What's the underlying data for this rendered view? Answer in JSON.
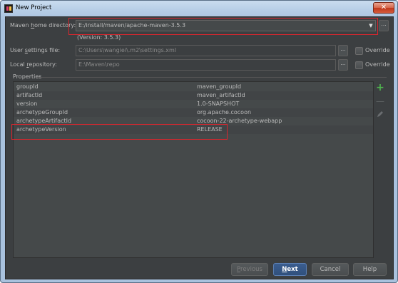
{
  "window": {
    "title": "New Project",
    "close_label": "✕"
  },
  "maven_home": {
    "label_pre": "Maven ",
    "label_u": "h",
    "label_post": "ome directory:",
    "value": "E:/install/maven/apache-maven-3.5.3",
    "version": "(Version: 3.5.3)"
  },
  "user_settings": {
    "label_pre": "User ",
    "label_u": "s",
    "label_post": "ettings file:",
    "value": "C:\\Users\\wangiei\\.m2\\settings.xml",
    "override_label": "Override",
    "override_checked": false
  },
  "local_repo": {
    "label_pre": "Local ",
    "label_u": "r",
    "label_post": "epository:",
    "value": "E:\\Maven\\repo",
    "override_label": "Override",
    "override_checked": false
  },
  "properties": {
    "title": "Properties",
    "rows": [
      {
        "key": "groupId",
        "value": "maven_groupId"
      },
      {
        "key": "artifactId",
        "value": "maven_artifactId"
      },
      {
        "key": "version",
        "value": "1.0-SNAPSHOT"
      },
      {
        "key": "archetypeGroupId",
        "value": "org.apache.cocoon"
      },
      {
        "key": "archetypeArtifactId",
        "value": "cocoon-22-archetype-webapp"
      },
      {
        "key": "archetypeVersion",
        "value": "RELEASE"
      }
    ],
    "add_icon": "plus-icon",
    "remove_icon": "minus-icon",
    "edit_icon": "pencil-icon",
    "add_color": "#4fb34f"
  },
  "buttons": {
    "previous": "Previous",
    "next": "Next",
    "cancel": "Cancel",
    "help": "Help"
  },
  "colors": {
    "highlight_box": "#d8262e",
    "background": "#3c3f41",
    "primary_button": "#365880"
  }
}
